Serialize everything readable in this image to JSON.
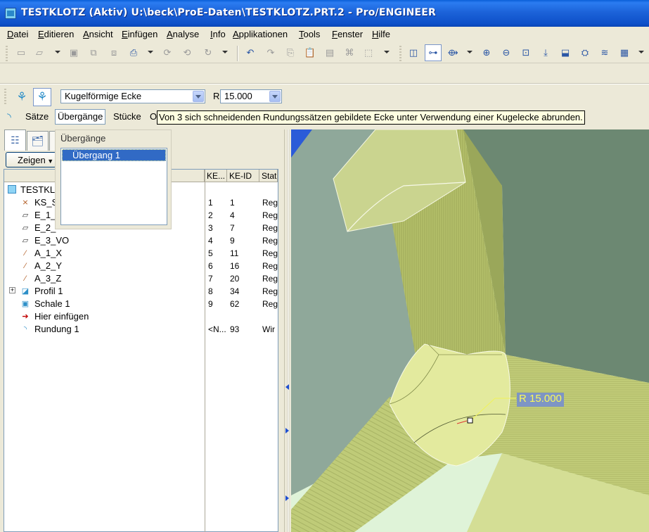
{
  "window": {
    "title": "TESTKLOTZ (Aktiv) U:\\beck\\ProE-Daten\\TESTKLOTZ.PRT.2 - Pro/ENGINEER"
  },
  "menu": [
    "Datei",
    "Editieren",
    "Ansicht",
    "Einfügen",
    "Analyse",
    "Info",
    "Applikationen",
    "Tools",
    "Fenster",
    "Hilfe"
  ],
  "dashboard": {
    "corner_type": "Kugelförmige Ecke",
    "radius_label": "R",
    "radius_value": "15.000",
    "tabs": [
      "Sätze",
      "Übergänge",
      "Stücke",
      "O"
    ],
    "tooltip": "Von 3 sich schneidenden Rundungssätzen gebildete Ecke unter Verwendung einer Kugelecke abrunden."
  },
  "transitions_panel": {
    "title": "Übergänge",
    "items": [
      "Übergang 1"
    ],
    "selected": 0
  },
  "model_tree": {
    "show_button": "Zeigen",
    "columns": [
      "KE...",
      "KE-ID",
      "Stat"
    ],
    "root": "TESTKL",
    "rows": [
      {
        "name": "KS_S",
        "icon": "csys-icon",
        "ke": "1",
        "id": "1",
        "status": "Reg"
      },
      {
        "name": "E_1_",
        "icon": "datum-plane-icon",
        "ke": "2",
        "id": "4",
        "status": "Reg"
      },
      {
        "name": "E_2_",
        "icon": "datum-plane-icon",
        "ke": "3",
        "id": "7",
        "status": "Reg"
      },
      {
        "name": "E_3_VO",
        "icon": "datum-plane-icon",
        "ke": "4",
        "id": "9",
        "status": "Reg"
      },
      {
        "name": "A_1_X",
        "icon": "datum-axis-icon",
        "ke": "5",
        "id": "11",
        "status": "Reg"
      },
      {
        "name": "A_2_Y",
        "icon": "datum-axis-icon",
        "ke": "6",
        "id": "16",
        "status": "Reg"
      },
      {
        "name": "A_3_Z",
        "icon": "datum-axis-icon",
        "ke": "7",
        "id": "20",
        "status": "Reg"
      },
      {
        "name": "Profil 1",
        "icon": "extrude-icon",
        "ke": "8",
        "id": "34",
        "status": "Reg"
      },
      {
        "name": "Schale 1",
        "icon": "shell-icon",
        "ke": "9",
        "id": "62",
        "status": "Reg"
      },
      {
        "name": "Hier einfügen",
        "icon": "insert-arrow-icon",
        "ke": "",
        "id": "",
        "status": ""
      },
      {
        "name": "Rundung 1",
        "icon": "round-icon",
        "ke": "<N...",
        "id": "93",
        "status": "Wir"
      }
    ]
  },
  "viewport": {
    "dimension_label": "R 15.000"
  },
  "colors": {
    "titlebar": "#0a5fd8",
    "selection": "#316ac5",
    "tooltip_bg": "#ffffe1",
    "model_face": "#c8d48a",
    "dimension_bg": "#7e95c4",
    "dimension_text": "#f9f95a"
  }
}
